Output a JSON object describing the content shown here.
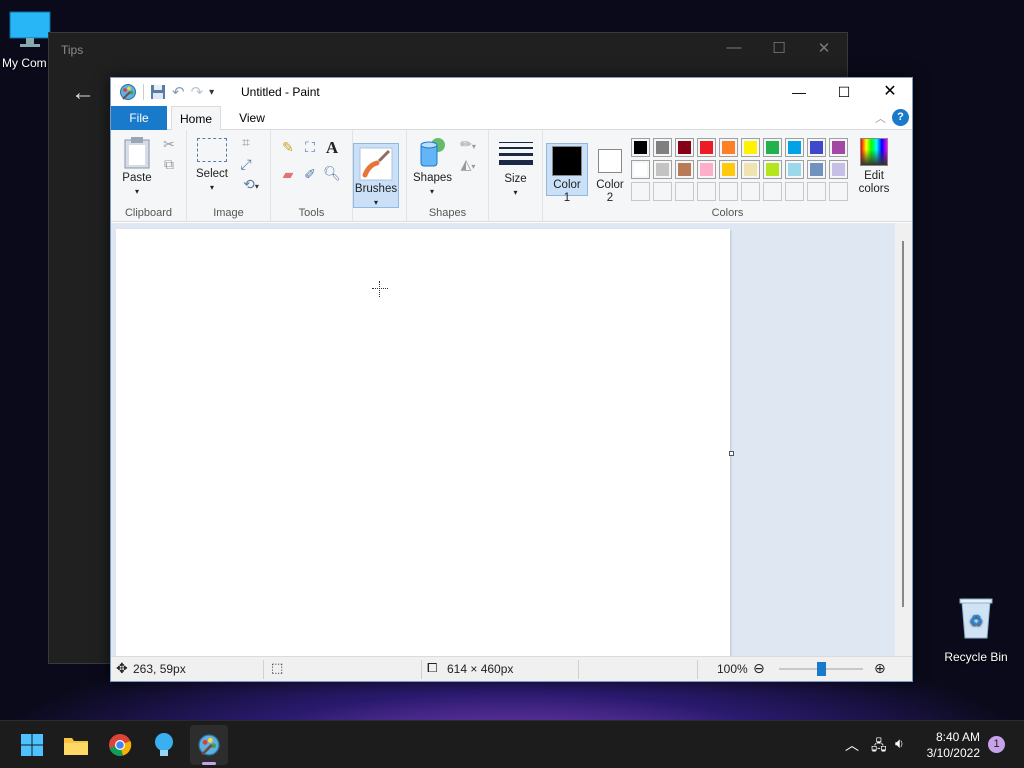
{
  "desktop": {
    "my_computer_label": "My Com",
    "recycle_bin_label": "Recycle Bin"
  },
  "tips_window": {
    "title": "Tips"
  },
  "paint": {
    "title": "Untitled - Paint",
    "tabs": {
      "file": "File",
      "home": "Home",
      "view": "View"
    },
    "help": "?",
    "groups": {
      "clipboard": {
        "label": "Clipboard",
        "paste": "Paste"
      },
      "image": {
        "label": "Image",
        "select": "Select"
      },
      "tools": {
        "label": "Tools"
      },
      "brushes": {
        "label": "Brushes"
      },
      "shapes": {
        "label": "Shapes",
        "shapes": "Shapes"
      },
      "size": {
        "label": "Size"
      },
      "colors": {
        "label": "Colors",
        "color1": "Color",
        "color1_num": "1",
        "color2": "Color",
        "color2_num": "2",
        "edit": "Edit",
        "edit2": "colors"
      }
    },
    "palette_row1": [
      "#000000",
      "#7f7f7f",
      "#880015",
      "#ed1c24",
      "#ff7f27",
      "#fff200",
      "#22b14c",
      "#00a2e8",
      "#3f48cc",
      "#a349a4"
    ],
    "palette_row2": [
      "#ffffff",
      "#c3c3c3",
      "#b97a57",
      "#ffaec9",
      "#ffc90e",
      "#efe4b0",
      "#b5e61d",
      "#99d9ea",
      "#7092be",
      "#c8bfe7"
    ],
    "color1_value": "#000000",
    "color2_value": "#ffffff",
    "status": {
      "cursor_pos": "263, 59px",
      "canvas_size": "614 × 460px",
      "zoom": "100%",
      "zoom_level": 1.0
    }
  },
  "taskbar": {
    "time": "8:40 AM",
    "date": "3/10/2022",
    "notifications": "1"
  }
}
